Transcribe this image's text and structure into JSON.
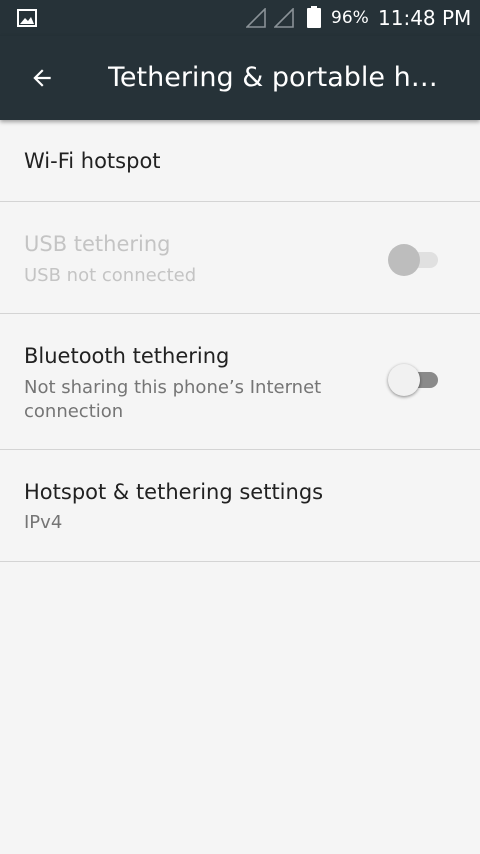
{
  "status_bar": {
    "battery_percent": "96%",
    "time": "11:48 PM",
    "icons": [
      "gallery-icon",
      "signal-icon",
      "signal-icon",
      "battery-icon"
    ]
  },
  "app_bar": {
    "back_icon": "arrow-back-icon",
    "title": "Tethering & portable h…"
  },
  "items": {
    "wifi_hotspot": {
      "title": "Wi-Fi hotspot"
    },
    "usb_tethering": {
      "title": "USB tethering",
      "summary": "USB not connected",
      "enabled": false,
      "checked": false
    },
    "bluetooth_tethering": {
      "title": "Bluetooth tethering",
      "summary": "Not sharing this phone’s Internet connection",
      "enabled": true,
      "checked": false
    },
    "hotspot_settings": {
      "title": "Hotspot & tethering settings",
      "summary": "IPv4"
    }
  },
  "colors": {
    "toolbar": "#263238",
    "background": "#f5f5f5",
    "primary_text": "#212121",
    "secondary_text": "#757575",
    "disabled_text": "#c4c4c4",
    "divider": "#d4d4d4"
  }
}
